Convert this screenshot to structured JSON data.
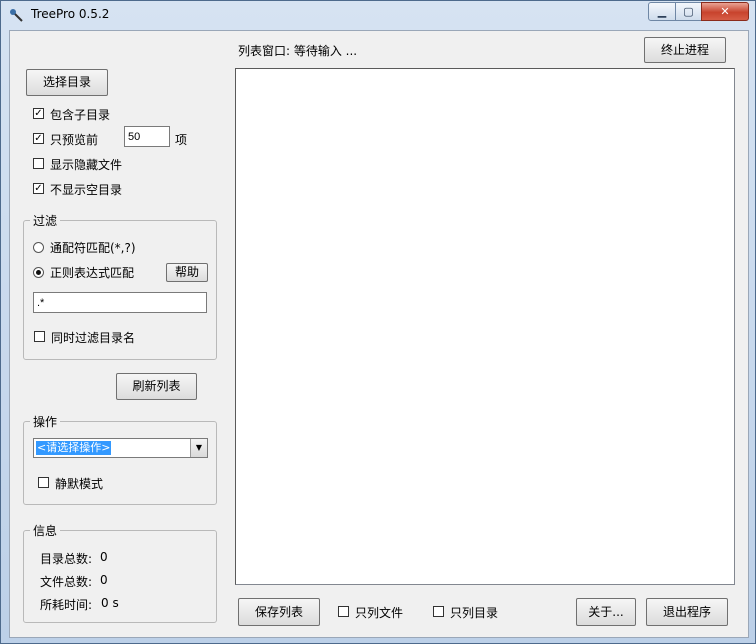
{
  "window": {
    "title": "TreePro 0.5.2",
    "controls": {
      "minimize": "▁",
      "maximize": "▢",
      "close": "✕"
    }
  },
  "list": {
    "status": "列表窗口: 等待输入 ...",
    "stop_button": "终止进程"
  },
  "options": {
    "choose_dir_button": "选择目录",
    "include_subdirs": {
      "label": "包含子目录",
      "checked": true
    },
    "preview_only": {
      "label": "只预览前",
      "checked": true,
      "value": "50",
      "suffix": "项"
    },
    "show_hidden": {
      "label": "显示隐藏文件",
      "checked": false
    },
    "hide_empty_dirs": {
      "label": "不显示空目录",
      "checked": true
    }
  },
  "filter": {
    "title": "过滤",
    "wildcard_label": "通配符匹配(*,?)",
    "regex_label": "正则表达式匹配",
    "mode": "regex",
    "help_button": "帮助",
    "pattern": ".*",
    "also_dirs": {
      "label": "同时过滤目录名",
      "checked": false
    }
  },
  "refresh_button": "刷新列表",
  "operation": {
    "title": "操作",
    "selected": "<请选择操作>",
    "silent": {
      "label": "静默模式",
      "checked": false
    }
  },
  "info": {
    "title": "信息",
    "dir_count_label": "目录总数:",
    "dir_count": "0",
    "file_count_label": "文件总数:",
    "file_count": "0",
    "time_label": "所耗时间:",
    "time_value": "0 s"
  },
  "footer": {
    "save_button": "保存列表",
    "files_only": {
      "label": "只列文件",
      "checked": false
    },
    "dirs_only": {
      "label": "只列目录",
      "checked": false
    },
    "about_button": "关于...",
    "exit_button": "退出程序"
  },
  "colors": {
    "titlebar": "#c9d8ea",
    "client": "#f0f0f0",
    "close": "#c8432d"
  }
}
